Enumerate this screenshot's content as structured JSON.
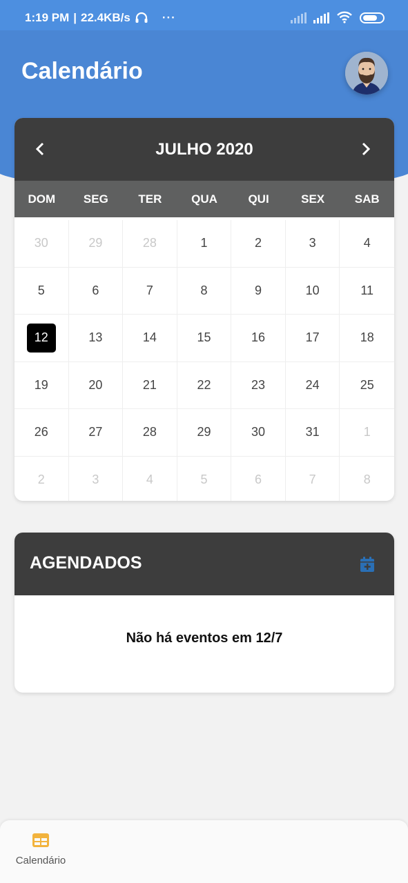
{
  "status": {
    "time": "1:19 PM",
    "speed": "22.4KB/s",
    "more": "···"
  },
  "header": {
    "title": "Calendário"
  },
  "calendar": {
    "month_label": "JULHO 2020",
    "prev_icon": "chevron-left-icon",
    "next_icon": "chevron-right-icon",
    "weekdays": [
      "DOM",
      "SEG",
      "TER",
      "QUA",
      "QUI",
      "SEX",
      "SAB"
    ],
    "days": [
      {
        "label": "30",
        "muted": true
      },
      {
        "label": "29",
        "muted": true
      },
      {
        "label": "28",
        "muted": true
      },
      {
        "label": "1"
      },
      {
        "label": "2"
      },
      {
        "label": "3"
      },
      {
        "label": "4"
      },
      {
        "label": "5"
      },
      {
        "label": "6"
      },
      {
        "label": "7"
      },
      {
        "label": "8"
      },
      {
        "label": "9"
      },
      {
        "label": "10"
      },
      {
        "label": "11"
      },
      {
        "label": "12",
        "selected": true
      },
      {
        "label": "13"
      },
      {
        "label": "14"
      },
      {
        "label": "15"
      },
      {
        "label": "16"
      },
      {
        "label": "17"
      },
      {
        "label": "18"
      },
      {
        "label": "19"
      },
      {
        "label": "20"
      },
      {
        "label": "21"
      },
      {
        "label": "22"
      },
      {
        "label": "23"
      },
      {
        "label": "24"
      },
      {
        "label": "25"
      },
      {
        "label": "26"
      },
      {
        "label": "27"
      },
      {
        "label": "28"
      },
      {
        "label": "29"
      },
      {
        "label": "30"
      },
      {
        "label": "31"
      },
      {
        "label": "1",
        "muted": true
      },
      {
        "label": "2",
        "muted": true
      },
      {
        "label": "3",
        "muted": true
      },
      {
        "label": "4",
        "muted": true
      },
      {
        "label": "5",
        "muted": true
      },
      {
        "label": "6",
        "muted": true
      },
      {
        "label": "7",
        "muted": true
      },
      {
        "label": "8",
        "muted": true
      }
    ]
  },
  "agendados": {
    "title": "AGENDADOS",
    "add_icon": "calendar-plus-icon",
    "empty_message": "Não há eventos em 12/7"
  },
  "bottom_nav": {
    "items": [
      {
        "label": "Calendário",
        "icon": "calendar-grid-icon",
        "active": true
      }
    ]
  },
  "colors": {
    "header_blue": "#4a86d4",
    "card_header": "#3d3d3d",
    "weekday_bar": "#5f6060",
    "accent_icon": "#2a6fb5",
    "nav_active_icon": "#f2b33d"
  }
}
